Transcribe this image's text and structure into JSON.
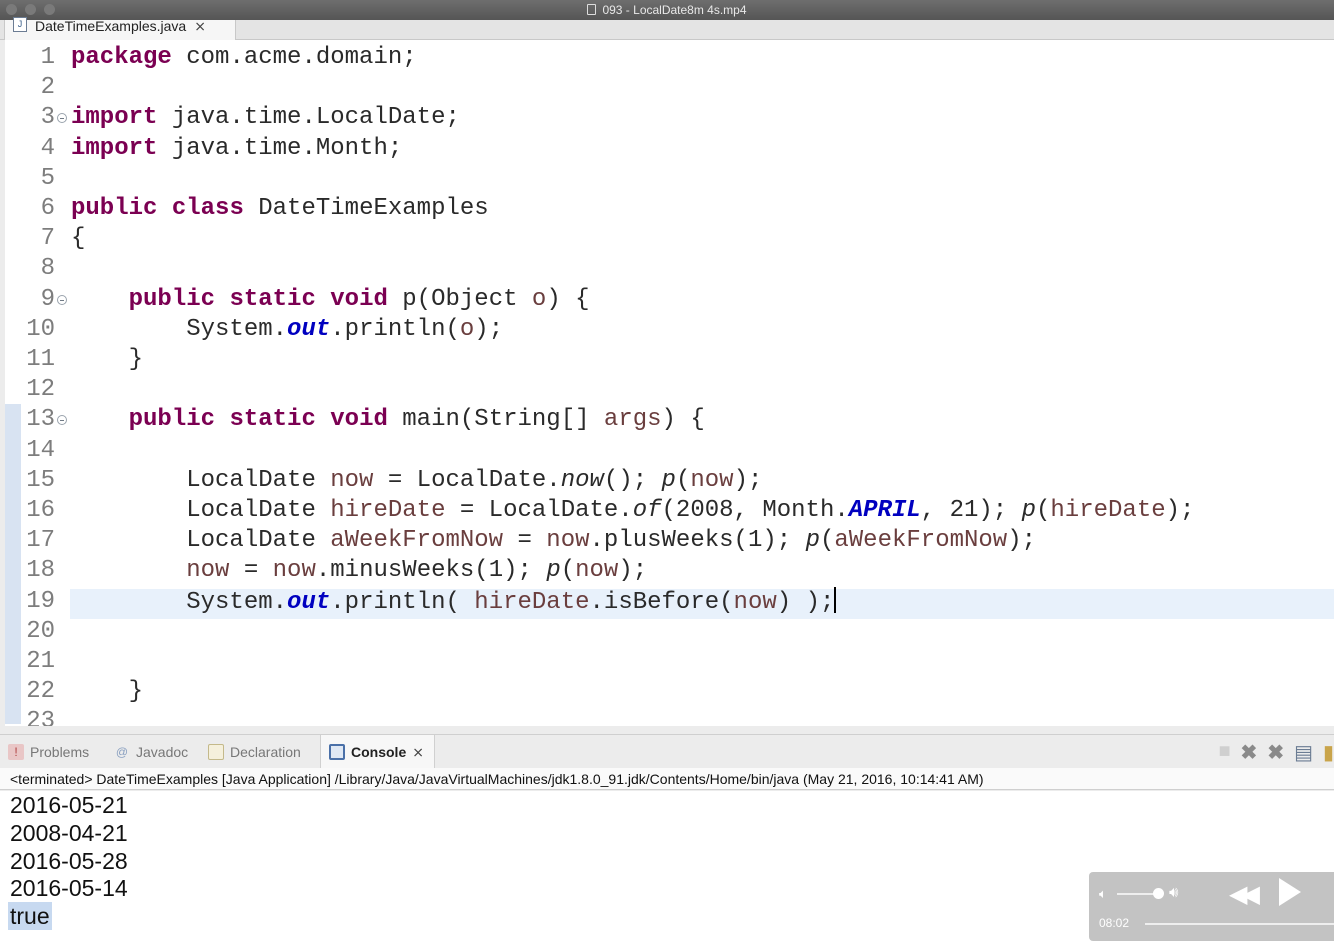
{
  "window": {
    "title": "093 - LocalDate8m 4s.mp4"
  },
  "editor": {
    "tab_label": "DateTimeExamples.java",
    "lines": [
      {
        "n": "1",
        "fold": false,
        "html": "<span class=\"k\">package</span> com.acme.domain;"
      },
      {
        "n": "2",
        "fold": false,
        "html": ""
      },
      {
        "n": "3",
        "fold": true,
        "html": "<span class=\"k\">import</span> java.time.LocalDate;"
      },
      {
        "n": "4",
        "fold": false,
        "html": "<span class=\"k\">import</span> java.time.Month;"
      },
      {
        "n": "5",
        "fold": false,
        "html": ""
      },
      {
        "n": "6",
        "fold": false,
        "html": "<span class=\"k\">public</span> <span class=\"k\">class</span> DateTimeExamples"
      },
      {
        "n": "7",
        "fold": false,
        "html": "{"
      },
      {
        "n": "8",
        "fold": false,
        "html": ""
      },
      {
        "n": "9",
        "fold": true,
        "html": "    <span class=\"k\">public</span> <span class=\"k\">static</span> <span class=\"k\">void</span> p(Object <span class=\"p\">o</span>) {"
      },
      {
        "n": "10",
        "fold": false,
        "html": "        System.<span class=\"f\">out</span>.println(<span class=\"p\">o</span>);"
      },
      {
        "n": "11",
        "fold": false,
        "html": "    }"
      },
      {
        "n": "12",
        "fold": false,
        "html": ""
      },
      {
        "n": "13",
        "fold": true,
        "html": "    <span class=\"k\">public</span> <span class=\"k\">static</span> <span class=\"k\">void</span> main(String[] <span class=\"p\">args</span>) {"
      },
      {
        "n": "14",
        "fold": false,
        "html": ""
      },
      {
        "n": "15",
        "fold": false,
        "html": "        LocalDate <span class=\"v\">now</span> = LocalDate.<span class=\"st\">now</span>(); <span class=\"st\">p</span>(<span class=\"v\">now</span>);"
      },
      {
        "n": "16",
        "fold": false,
        "html": "        LocalDate <span class=\"v\">hireDate</span> = LocalDate.<span class=\"st\">of</span>(2008, Month.<span class=\"f\">APRIL</span>, 21); <span class=\"st\">p</span>(<span class=\"v\">hireDate</span>);"
      },
      {
        "n": "17",
        "fold": false,
        "html": "        LocalDate <span class=\"v\">aWeekFromNow</span> = <span class=\"v\">now</span>.plusWeeks(1); <span class=\"st\">p</span>(<span class=\"v\">aWeekFromNow</span>);"
      },
      {
        "n": "18",
        "fold": false,
        "html": "        <span class=\"v\">now</span> = <span class=\"v\">now</span>.minusWeeks(1); <span class=\"st\">p</span>(<span class=\"v\">now</span>);"
      },
      {
        "n": "19",
        "fold": false,
        "html": "        System.<span class=\"f\">out</span>.println( <span class=\"v\">hireDate</span>.isBefore(<span class=\"v\">now</span>) );<span class=\"caret\"></span>"
      },
      {
        "n": "20",
        "fold": false,
        "html": ""
      },
      {
        "n": "21",
        "fold": false,
        "html": ""
      },
      {
        "n": "22",
        "fold": false,
        "html": "    }"
      },
      {
        "n": "23",
        "fold": false,
        "html": ""
      }
    ]
  },
  "panel": {
    "tabs": {
      "problems": "Problems",
      "javadoc": "Javadoc",
      "declaration": "Declaration",
      "console": "Console"
    },
    "console_header": "<terminated> DateTimeExamples [Java Application] /Library/Java/JavaVirtualMachines/jdk1.8.0_91.jdk/Contents/Home/bin/java (May 21, 2016, 10:14:41 AM)",
    "output": [
      "2016-05-21",
      "2008-04-21",
      "2016-05-28",
      "2016-05-14",
      "true"
    ]
  },
  "video": {
    "time": "08:02"
  },
  "icons": {
    "problems": "problems-icon",
    "javadoc": "javadoc-icon",
    "declaration": "declaration-icon",
    "console": "console-icon",
    "terminate": "stop-icon",
    "remove": "remove-launch-icon",
    "remove_all": "remove-all-icon"
  }
}
